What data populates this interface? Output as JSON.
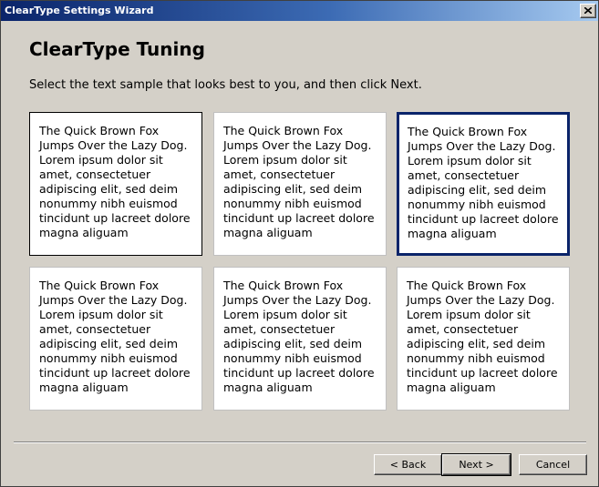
{
  "window": {
    "title": "ClearType Settings Wizard"
  },
  "page": {
    "title": "ClearType Tuning",
    "instruction": "Select the text sample that looks best to you, and then click Next."
  },
  "samples": [
    {
      "text": "The Quick Brown Fox\nJumps Over the Lazy Dog.\nLorem ipsum dolor sit\namet, consectetuer\nadipiscing elit, sed deim\nnonummy nibh euismod\ntincidunt up lacreet dolore\nmagna aliguam",
      "state": "focused"
    },
    {
      "text": "The Quick Brown Fox\nJumps Over the Lazy Dog.\nLorem ipsum dolor sit\namet, consectetuer\nadipiscing elit, sed deim\nnonummy nibh euismod\ntincidunt up lacreet dolore\nmagna aliguam",
      "state": "normal"
    },
    {
      "text": "The Quick Brown Fox\nJumps Over the Lazy Dog.\nLorem ipsum dolor sit\namet, consectetuer\nadipiscing elit, sed deim\nnonummy nibh euismod\ntincidunt up lacreet dolore\nmagna aliguam",
      "state": "selected"
    },
    {
      "text": "The Quick Brown Fox\nJumps Over the Lazy Dog.\nLorem ipsum dolor sit\namet, consectetuer\nadipiscing elit, sed deim\nnonummy nibh euismod\ntincidunt up lacreet dolore\nmagna aliguam",
      "state": "normal"
    },
    {
      "text": "The Quick Brown Fox\nJumps Over the Lazy Dog.\nLorem ipsum dolor sit\namet, consectetuer\nadipiscing elit, sed deim\nnonummy nibh euismod\ntincidunt up lacreet dolore\nmagna aliguam",
      "state": "normal"
    },
    {
      "text": "The Quick Brown Fox\nJumps Over the Lazy Dog.\nLorem ipsum dolor sit\namet, consectetuer\nadipiscing elit, sed deim\nnonummy nibh euismod\ntincidunt up lacreet dolore\nmagna aliguam",
      "state": "normal"
    }
  ],
  "buttons": {
    "back": "< Back",
    "next": "Next >",
    "cancel": "Cancel"
  },
  "icons": {
    "close": "close-icon"
  },
  "colors": {
    "title_bar_start": "#0a246a",
    "title_bar_end": "#a6caf0",
    "selected_border": "#0a246a",
    "dialog_background": "#d4d0c8"
  }
}
